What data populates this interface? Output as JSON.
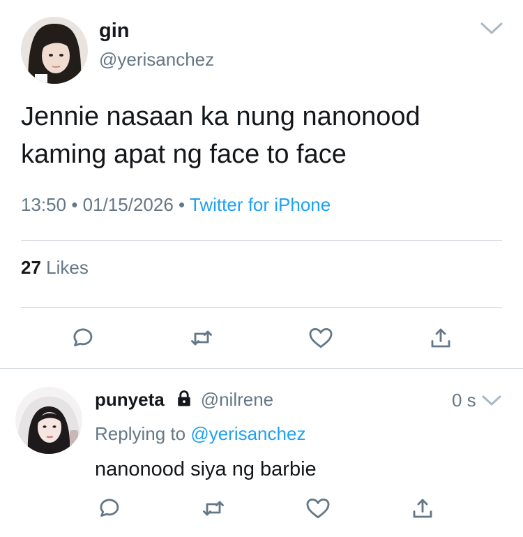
{
  "tweet": {
    "display_name": "gin",
    "handle": "@yerisanchez",
    "text": "Jennie nasaan ka nung nanonood kaming apat ng face to face",
    "time": "13:50",
    "date": "01/15/2026",
    "separator": "•",
    "source": "Twitter for iPhone",
    "likes_count": "27",
    "likes_label": "Likes",
    "avatar_icon": "profile-photo",
    "menu_icon": "chevron-down-icon",
    "actions": [
      "reply-icon",
      "retweet-icon",
      "like-icon",
      "share-icon"
    ]
  },
  "reply": {
    "display_name": "punyeta",
    "handle": "@nilrene",
    "protected_icon": "lock-icon",
    "time": "0 s",
    "replying_prefix": "Replying to",
    "replying_to": "@yerisanchez",
    "text": "nanonood siya ng barbie",
    "avatar_icon": "profile-photo",
    "menu_icon": "chevron-down-icon",
    "actions": [
      "reply-icon",
      "retweet-icon",
      "like-icon",
      "share-icon"
    ]
  },
  "colors": {
    "text_primary": "#14171a",
    "text_secondary": "#657786",
    "link": "#1da1f2",
    "divider": "#d8dde2",
    "icon": "#657786"
  }
}
